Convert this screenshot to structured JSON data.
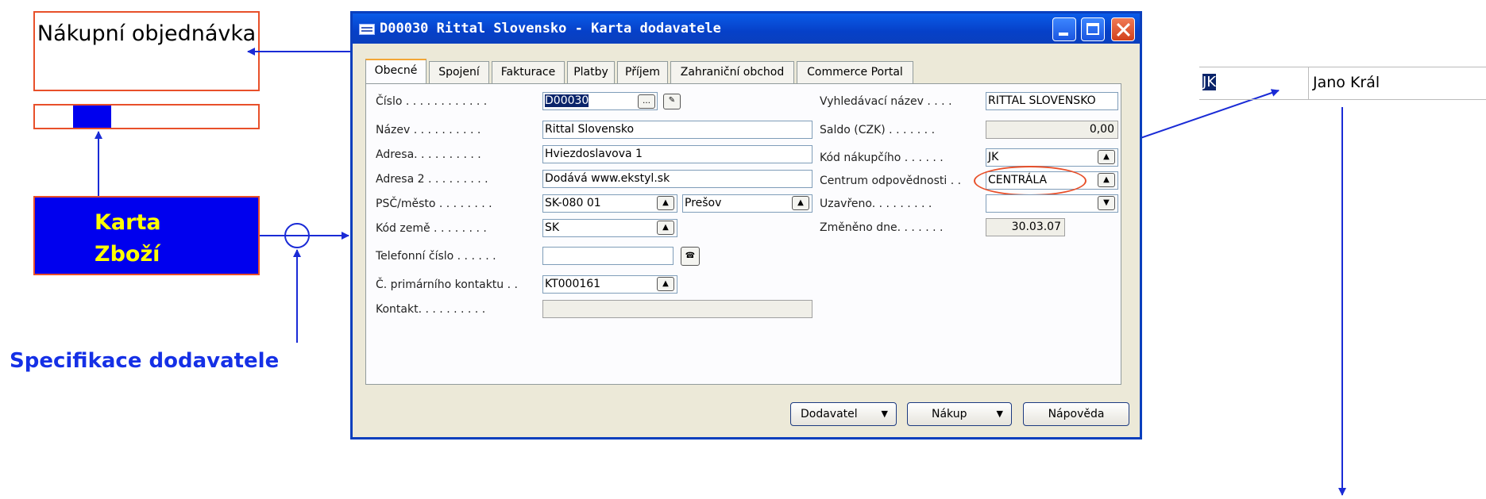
{
  "diagram": {
    "purchase_order": "Nákupní objednávka",
    "item_card_line1": "Karta",
    "item_card_line2": "Zboží",
    "vendor_spec": "Specifikace dodavatele",
    "accent": "#0000ee",
    "box_border": "#e8502a"
  },
  "window": {
    "title": "D00030 Rittal Slovensko - Karta dodavatele",
    "tabs": [
      "Obecné",
      "Spojení",
      "Fakturace",
      "Platby",
      "Příjem",
      "Zahraniční obchod",
      "Commerce Portal"
    ],
    "active_tab": "Obecné",
    "left_fields": {
      "cislo": {
        "label": "Číslo . . . . . . . . . . . .",
        "value": "D00030"
      },
      "nazev": {
        "label": "Název . . . . . . . . . .",
        "value": "Rittal Slovensko"
      },
      "adresa": {
        "label": "Adresa. . . . . . . . . .",
        "value": "Hviezdoslavova 1"
      },
      "adresa2": {
        "label": "Adresa 2 . . . . . . . . .",
        "value": "Dodává www.ekstyl.sk"
      },
      "psc": {
        "label": "PSČ/město . . . . . . . .",
        "value": "SK-080 01",
        "city": "Prešov"
      },
      "kod_zeme": {
        "label": "Kód země . . . . . . . .",
        "value": "SK"
      },
      "telefon": {
        "label": "Telefonní číslo . . . . . .",
        "value": ""
      },
      "kontakt_primarni": {
        "label": "Č. primárního kontaktu . .",
        "value": "KT000161"
      },
      "kontakt": {
        "label": "Kontakt. . . . . . . . . .",
        "value": ""
      }
    },
    "right_fields": {
      "vyhledavaci": {
        "label": "Vyhledávací název . . . .",
        "value": "RITTAL SLOVENSKO"
      },
      "saldo": {
        "label": "Saldo (CZK) . . . . . . .",
        "value": "0,00"
      },
      "nakupci": {
        "label": "Kód nákupčího . . . . . .",
        "value": "JK"
      },
      "centrum": {
        "label": "Centrum odpovědnosti . .",
        "value": "CENTRÁLA"
      },
      "uzavreno": {
        "label": "Uzavřeno. . . . . . . . .",
        "value": ""
      },
      "zmeneno": {
        "label": "Změněno dne. . . . . . .",
        "value": "30.03.07"
      }
    },
    "buttons": {
      "dodavatel": "Dodavatel",
      "nakup": "Nákup",
      "napoveda": "Nápověda"
    }
  },
  "purchaser_table": {
    "code": "JK",
    "name": "Jano Král"
  }
}
